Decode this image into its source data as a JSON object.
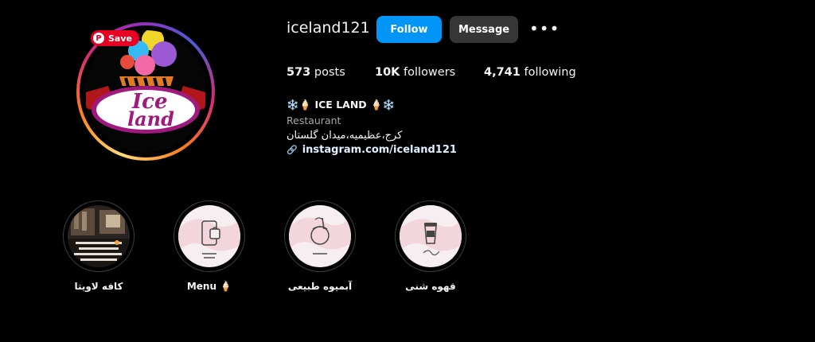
{
  "badge": {
    "save_label": "Save",
    "pin_glyph": "P"
  },
  "profile": {
    "username": "iceland121",
    "follow_label": "Follow",
    "message_label": "Message",
    "more_label": "•••",
    "avatar_text_top": "Ice",
    "avatar_text_bottom": "land"
  },
  "stats": {
    "posts_count": "573",
    "posts_label": "posts",
    "followers_count": "10K",
    "followers_label": "followers",
    "following_count": "4,741",
    "following_label": "following"
  },
  "bio": {
    "name": "❄️🍦 ICE LAND 🍦❄️",
    "category": "Restaurant",
    "location": "کرج،عظیمیه،میدان گلستان",
    "link": "instagram.com/iceland121",
    "link_icon": "🔗"
  },
  "highlights": [
    {
      "label": "کافه لاویتا",
      "icon": "cafe-photo"
    },
    {
      "label": "Menu 🍦",
      "icon": "phone-bag-icon"
    },
    {
      "label": "آبمیوه طبیعی",
      "icon": "coconut-drink-icon"
    },
    {
      "label": "قهوه شنی",
      "icon": "coffee-cup-icon"
    }
  ],
  "colors": {
    "background": "#000000",
    "follow_button": "#0095f6",
    "message_button": "#363636",
    "pinterest_red": "#e60023",
    "highlight_pink": "#f3d9dc"
  }
}
